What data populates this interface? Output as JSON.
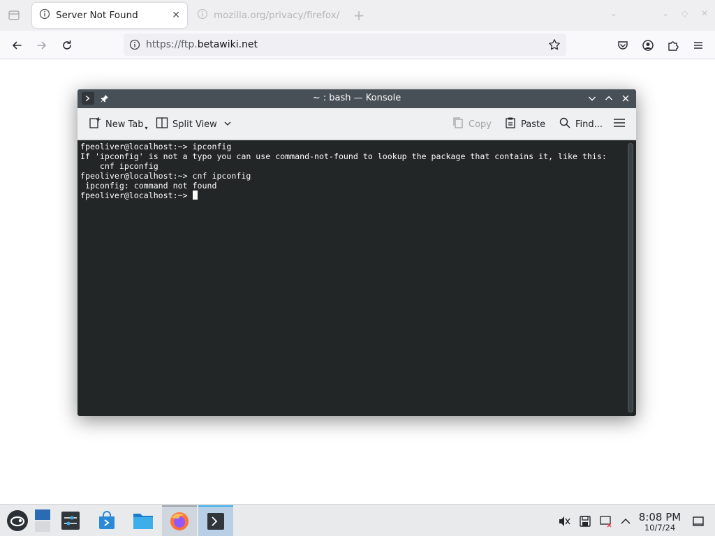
{
  "browser": {
    "tabs": [
      {
        "title": "Server Not Found",
        "active": true
      },
      {
        "title": "mozilla.org/privacy/firefox/",
        "active": false
      }
    ],
    "url": {
      "prefix": "https://ftp.",
      "domain": "betawiki.net"
    }
  },
  "konsole": {
    "title": "~ : bash — Konsole",
    "toolbar": {
      "new_tab": "New Tab",
      "split_view": "Split View",
      "copy": "Copy",
      "paste": "Paste",
      "find": "Find..."
    },
    "terminal_lines": [
      "fpeoliver@localhost:~> ipconfig",
      "If 'ipconfig' is not a typo you can use command-not-found to lookup the package that contains it, like this:",
      "    cnf ipconfig",
      "fpeoliver@localhost:~> cnf ipconfig",
      " ipconfig: command not found"
    ],
    "prompt": "fpeoliver@localhost:~> "
  },
  "taskbar": {
    "apps": [
      "application-launcher",
      "desktop-pager",
      "system-settings",
      "discover",
      "dolphin",
      "firefox",
      "konsole"
    ],
    "time": "8:08 PM",
    "date": "10/7/24"
  },
  "colors": {
    "accent": "#3daee9",
    "terminal_bg": "#232627",
    "titlebar": "#475057"
  }
}
